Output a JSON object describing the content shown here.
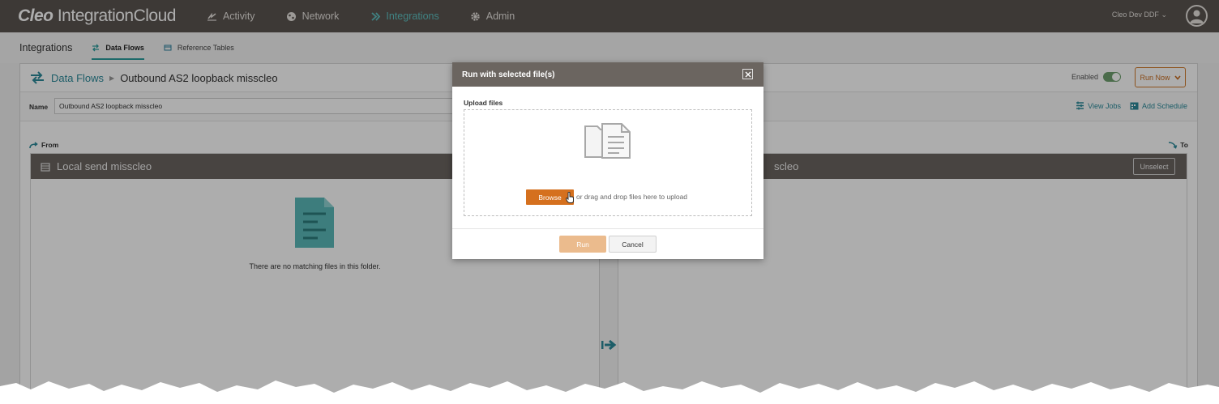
{
  "app": {
    "logo_bold": "Cleo",
    "logo_rest": " IntegrationCloud"
  },
  "nav": {
    "items": [
      {
        "label": "Activity",
        "icon": "activity-icon"
      },
      {
        "label": "Network",
        "icon": "network-icon"
      },
      {
        "label": "Integrations",
        "icon": "integrations-icon",
        "active": true
      },
      {
        "label": "Admin",
        "icon": "gear-icon"
      }
    ],
    "user": "Cleo Dev DDF"
  },
  "subnav": {
    "title": "Integrations",
    "tabs": [
      {
        "label": "Data Flows",
        "active": true
      },
      {
        "label": "Reference Tables",
        "active": false
      }
    ]
  },
  "flow": {
    "breadcrumb_root": "Data Flows",
    "breadcrumb_current": "Outbound AS2 loopback misscleo",
    "enabled_label": "Enabled",
    "run_now_label": "Run Now",
    "name_label": "Name",
    "name_value": "Outbound AS2 loopback misscleo",
    "view_jobs_label": "View Jobs",
    "add_schedule_label": "Add Schedule",
    "from_label": "From",
    "to_label": "To",
    "source_title": "Local send misscleo",
    "source_empty_text": "There are no matching files in this folder.",
    "dest_title_visible": "scleo",
    "unselect_label": "Unselect"
  },
  "modal": {
    "title": "Run with selected file(s)",
    "upload_label": "Upload files",
    "browse_label": "Browse",
    "drag_text": "or drag and drop files here to upload",
    "run_label": "Run",
    "cancel_label": "Cancel"
  },
  "colors": {
    "topnav_bg": "#5a5450",
    "accent_teal": "#2b8a9a",
    "nav_active": "#5fc0c0",
    "orange": "#d5701e"
  }
}
